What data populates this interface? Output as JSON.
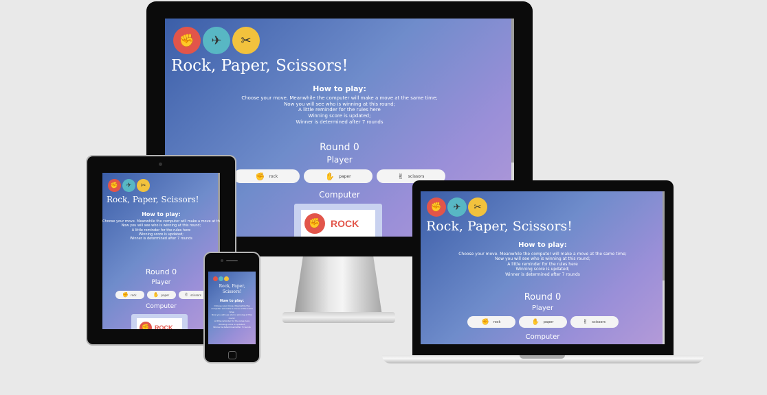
{
  "app": {
    "title": "Rock, Paper, Scissors!",
    "how_to_title": "How to play:",
    "how_to_lines": [
      "Choose your move. Meanwhile the computer will make a move at the same time;",
      "Now you will see who is winning at this round;",
      "A little reminder for the rules here",
      "Winning score is updated;",
      "Winner is determined after 7 rounds"
    ],
    "round_label": "Round 0",
    "player_label": "Player",
    "computer_label": "Computer",
    "buttons": {
      "rock": "rock",
      "paper": "paper",
      "scissors": "scissors"
    },
    "computer_choice": "ROCK",
    "logo_icons": [
      "rock-hand-icon",
      "paper-plane-icon",
      "scissors-icon"
    ]
  },
  "colors": {
    "background": "#e9e9e9",
    "gradient_start": "#3b5ea8",
    "gradient_end": "#b49ad8",
    "rock": "#e2554a",
    "paper": "#58b7c4",
    "scissors": "#f2c23d"
  }
}
